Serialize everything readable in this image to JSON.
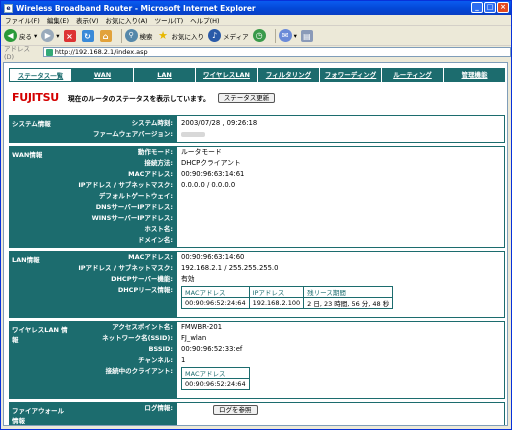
{
  "window": {
    "title": "Wireless Broadband Router - Microsoft Internet Explorer"
  },
  "menu": [
    "ファイル(F)",
    "編集(E)",
    "表示(V)",
    "お気に入り(A)",
    "ツール(T)",
    "ヘルプ(H)"
  ],
  "toolbar": {
    "back": "戻る",
    "search": "検索",
    "favorites": "お気に入り",
    "media": "メディア"
  },
  "address": {
    "label": "アドレス(D)",
    "url": "http://192.168.2.1/index.asp"
  },
  "nav": [
    "ステータス一覧",
    "WAN",
    "LAN",
    "ワイヤレスLAN",
    "フィルタリング",
    "フォワーディング",
    "ルーティング",
    "管理機能"
  ],
  "header": {
    "logo": "FUJITSU",
    "description": "現在のルータのステータスを表示しています。",
    "refresh": "ステータス更新"
  },
  "system": {
    "label": "システム情報",
    "keys": [
      "システム時刻:",
      "ファームウェアバージョン:"
    ],
    "values": [
      "2003/07/28 , 09:26:18",
      ""
    ]
  },
  "wan": {
    "label": "WAN情報",
    "keys": [
      "動作モード:",
      "接続方法:",
      "MACアドレス:",
      "IPアドレス / サブネットマスク:",
      "デフォルトゲートウェイ:",
      "DNSサーバーIPアドレス:",
      "WINSサーバーIPアドレス:",
      "ホスト名:",
      "ドメイン名:"
    ],
    "values": [
      "ルータモード",
      "DHCPクライアント",
      "00:90:96:63:14:61",
      "0.0.0.0 / 0.0.0.0",
      "",
      "",
      "",
      "",
      ""
    ]
  },
  "lan": {
    "label": "LAN情報",
    "keys": [
      "MACアドレス:",
      "IPアドレス / サブネットマスク:",
      "DHCPサーバー機能:",
      "DHCPリース情報:"
    ],
    "values": [
      "00:90:96:63:14:60",
      "192.168.2.1 / 255.255.255.0",
      "有効"
    ],
    "lease_headers": [
      "MACアドレス",
      "IPアドレス",
      "残リース期間"
    ],
    "lease_row": [
      "00:90:96:52:24:64",
      "192.168.2.100",
      "2 日, 23 時間, 56 分, 48 秒"
    ]
  },
  "wireless": {
    "label": "ワイヤレスLAN 情報",
    "keys": [
      "アクセスポイント名:",
      "ネットワーク名(SSID):",
      "BSSID:",
      "チャンネル:",
      "接続中のクライアント:"
    ],
    "values": [
      "FMWBR-201",
      "FJ_wlan",
      "00:90:96:52:33:ef",
      "1"
    ],
    "client_header": "MACアドレス",
    "client_row": "00:90:96:52:24:64"
  },
  "firewall": {
    "label": "ファイアウォール 情報",
    "key": "ログ情報:",
    "button": "ログを参照"
  }
}
